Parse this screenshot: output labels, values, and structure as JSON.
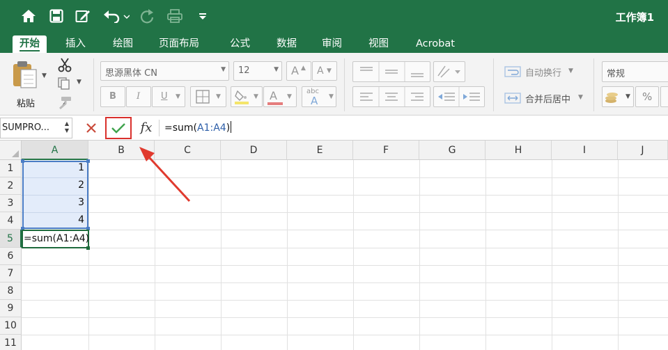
{
  "titlebar": {
    "document_title": "工作簿1",
    "icons": [
      "home-icon",
      "save-icon",
      "edit-icon",
      "undo-icon",
      "redo-icon",
      "print-icon",
      "customize-toolbar-icon"
    ]
  },
  "tabs": [
    {
      "label": "开始",
      "active": true
    },
    {
      "label": "插入"
    },
    {
      "label": "绘图"
    },
    {
      "label": "页面布局"
    },
    {
      "label": "公式"
    },
    {
      "label": "数据"
    },
    {
      "label": "审阅"
    },
    {
      "label": "视图"
    },
    {
      "label": "Acrobat"
    }
  ],
  "ribbon": {
    "paste_label": "粘贴",
    "font_name": "思源黑体 CN",
    "font_size": "12",
    "bold": "B",
    "italic": "I",
    "underline": "U",
    "wrap_text": "自动换行",
    "merge_center": "合并后居中",
    "number_format": "常规",
    "percent": "%",
    "increase_font": "A",
    "decrease_font": "A",
    "font_color_letter": "A",
    "phonetic": "abc"
  },
  "formula_bar": {
    "name_box": "SUMPRO...",
    "fx_label": "fx",
    "formula_prefix": "=sum(",
    "formula_ref": "A1:A4",
    "formula_suffix": ")"
  },
  "grid": {
    "columns": [
      "A",
      "B",
      "C",
      "D",
      "E",
      "F",
      "G",
      "H",
      "I",
      "J"
    ],
    "rows": [
      "1",
      "2",
      "3",
      "4",
      "5",
      "6",
      "7",
      "8",
      "9",
      "10",
      "11"
    ],
    "cells": {
      "A1": "1",
      "A2": "2",
      "A3": "3",
      "A4": "4",
      "A5": "=sum(A1:A4)"
    }
  },
  "colors": {
    "accent_green": "#217346",
    "annotation_red": "#d9302c",
    "reference_blue": "#4a7cc4"
  }
}
